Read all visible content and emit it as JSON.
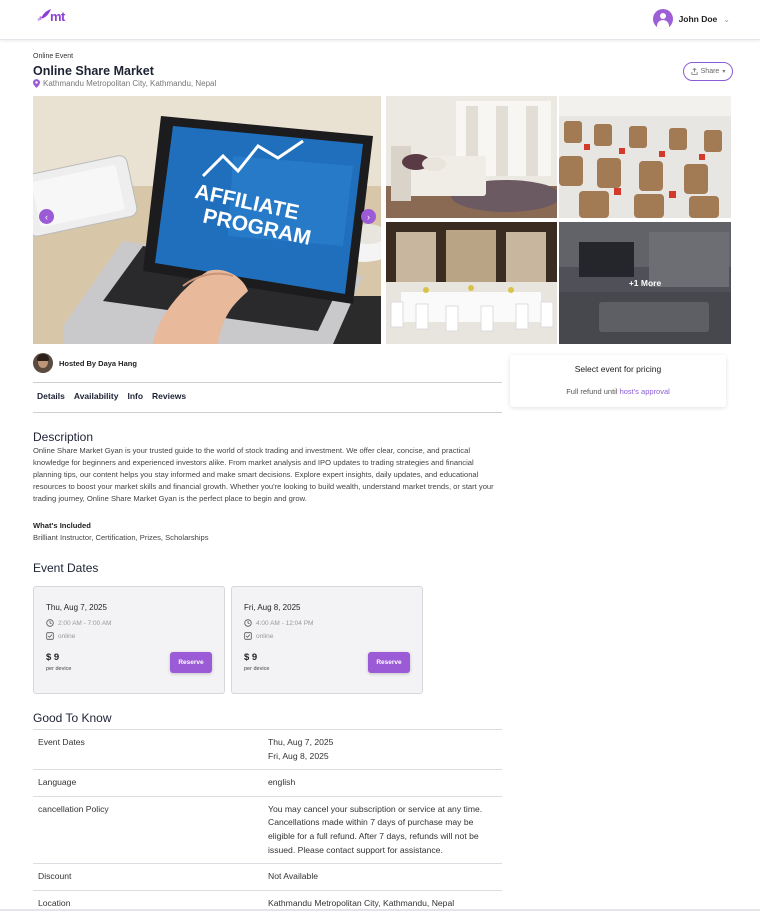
{
  "header": {
    "logo_text": "mt",
    "user_name": "John Doe"
  },
  "event": {
    "type": "Online Event",
    "title": "Online Share Market",
    "location": "Kathmandu Metropolitan City, Kathmandu, Nepal",
    "share_label": "Share"
  },
  "gallery": {
    "more_label": "+1 More",
    "main_image_text": [
      "AFFILIATE",
      "PROGRAM"
    ]
  },
  "host": {
    "label": "Hosted By Daya Hang"
  },
  "tabs": [
    {
      "label": "Details"
    },
    {
      "label": "Availability"
    },
    {
      "label": "Info"
    },
    {
      "label": "Reviews"
    }
  ],
  "pricing": {
    "title": "Select event for pricing",
    "refund_prefix": "Full refund until",
    "refund_link": "host's approval"
  },
  "description": {
    "heading": "Description",
    "text": "Online Share Market Gyan is your trusted guide to the world of stock trading and investment. We offer clear, concise, and practical knowledge for beginners and experienced investors alike. From market analysis and IPO updates to trading strategies and financial planning tips, our content helps you stay informed and make smart decisions. Explore expert insights, daily updates, and educational resources to boost your market skills and financial growth. Whether you're looking to build wealth, understand market trends, or start your trading journey, Online Share Market Gyan is the perfect place to begin and grow.",
    "included_label": "What's Included",
    "included_value": "Brilliant Instructor, Certification, Prizes, Scholarships"
  },
  "event_dates": {
    "heading": "Event Dates",
    "cards": [
      {
        "date": "Thu, Aug 7, 2025",
        "time": "2:00 AM - 7:00 AM",
        "mode": "online",
        "price": "$ 9",
        "per": "per device",
        "button": "Reserve"
      },
      {
        "date": "Fri, Aug 8, 2025",
        "time": "4:00 AM - 12:04 PM",
        "mode": "online",
        "price": "$ 9",
        "per": "per device",
        "button": "Reserve"
      }
    ]
  },
  "good_to_know": {
    "heading": "Good To Know",
    "rows": [
      {
        "key": "Event Dates",
        "value": "Thu, Aug 7, 2025\nFri, Aug 8, 2025"
      },
      {
        "key": "Language",
        "value": "english"
      },
      {
        "key": "cancellation Policy",
        "value": "You may cancel your subscription or service at any time. Cancellations made within 7 days of purchase may be eligible for a full refund. After 7 days, refunds will not be issued. Please contact support for assistance."
      },
      {
        "key": "Discount",
        "value": "Not Available"
      },
      {
        "key": "Location",
        "value": "Kathmandu Metropolitan City, Kathmandu, Nepal"
      }
    ]
  },
  "colors": {
    "accent": "#9b5bd6",
    "text_dark": "#1d2233"
  }
}
